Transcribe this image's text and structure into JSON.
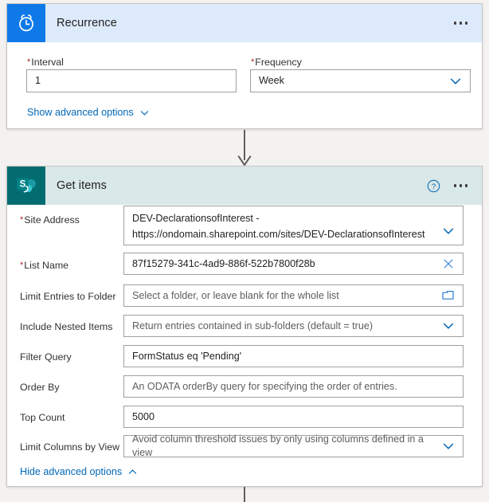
{
  "recurrence": {
    "title": "Recurrence",
    "icon": "alarm-clock-icon",
    "icon_tile_color": "#0f79e8",
    "header_bg": "#dceafb",
    "menu_icon": "ellipsis-icon",
    "fields": [
      {
        "label": "Interval",
        "required": true,
        "value": "1",
        "type": "text"
      },
      {
        "label": "Frequency",
        "required": true,
        "value": "Week",
        "type": "dropdown",
        "affix_icon": "chevron-down-icon"
      }
    ],
    "advanced_toggle": {
      "label": "Show advanced options",
      "icon": "chevron-down-icon"
    }
  },
  "connector": {
    "icon": "arrow-down-icon",
    "color": "#605e5c"
  },
  "get_items": {
    "title": "Get items",
    "icon": "sharepoint-icon",
    "icon_tile_color": "#036c70",
    "header_bg": "#d9e8e8",
    "help_icon": "question-circle-icon",
    "menu_icon": "ellipsis-icon",
    "fields": [
      {
        "label": "Site Address",
        "required": true,
        "value": "DEV-DeclarationsofInterest -",
        "value_line2": "https://ondomain.sharepoint.com/sites/DEV-DeclarationsofInterest",
        "is_placeholder": false,
        "type": "dropdown",
        "affix_icon": "chevron-down-icon"
      },
      {
        "label": "List Name",
        "required": true,
        "value": "87f15279-341c-4ad9-886f-522b7800f28b",
        "is_placeholder": false,
        "type": "text",
        "affix_icon": "close-x-icon"
      },
      {
        "label": "Limit Entries to Folder",
        "required": false,
        "value": "Select a folder, or leave blank for the whole list",
        "is_placeholder": true,
        "type": "picker",
        "affix_icon": "folder-icon"
      },
      {
        "label": "Include Nested Items",
        "required": false,
        "value": "Return entries contained in sub-folders (default = true)",
        "is_placeholder": true,
        "type": "dropdown",
        "affix_icon": "chevron-down-icon"
      },
      {
        "label": "Filter Query",
        "required": false,
        "value": "FormStatus eq 'Pending'",
        "is_placeholder": false,
        "type": "text",
        "affix_icon": ""
      },
      {
        "label": "Order By",
        "required": false,
        "value": "An ODATA orderBy query for specifying the order of entries.",
        "is_placeholder": true,
        "type": "text",
        "affix_icon": ""
      },
      {
        "label": "Top Count",
        "required": false,
        "value": "5000",
        "is_placeholder": false,
        "type": "text",
        "affix_icon": ""
      },
      {
        "label": "Limit Columns by View",
        "required": false,
        "value": "Avoid column threshold issues by only using columns defined in a view",
        "is_placeholder": true,
        "type": "dropdown",
        "affix_icon": "chevron-down-icon"
      }
    ],
    "advanced_toggle": {
      "label": "Hide advanced options",
      "icon": "chevron-up-icon"
    }
  },
  "colors": {
    "accent_blue": "#0067b8",
    "link_blue": "#0f6cbd",
    "required_red": "#a4262c",
    "page_bg": "#f3f2f1",
    "card_border": "#c8c6c4",
    "input_border": "#a19f9d"
  }
}
